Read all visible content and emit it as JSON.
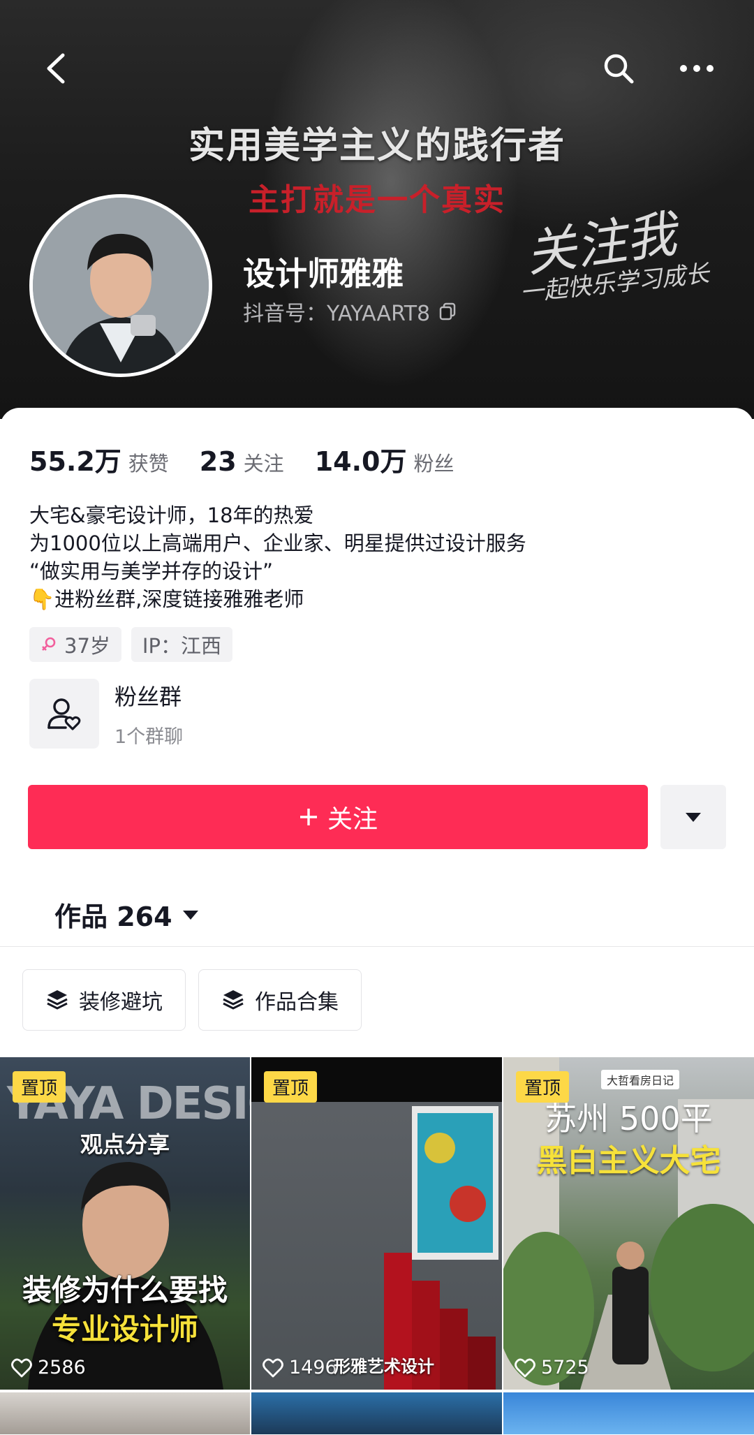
{
  "banner": {
    "headline": "实用美学主义的践行者",
    "subline": "主打就是一个真实",
    "script_big": "关注我",
    "script_small": "一起快乐学习成长"
  },
  "profile": {
    "name": "设计师雅雅",
    "douyin_id": "抖音号：YAYAART8"
  },
  "stats": [
    {
      "value": "55.2万",
      "label": "获赞"
    },
    {
      "value": "23",
      "label": "关注"
    },
    {
      "value": "14.0万",
      "label": "粉丝"
    }
  ],
  "bio": [
    "大宅&豪宅设计师，18年的热爱",
    "为1000位以上高端用户、企业家、明星提供过设计服务",
    "“做实用与美学并存的设计”",
    "👇进粉丝群,深度链接雅雅老师"
  ],
  "tags": {
    "age": "37岁",
    "ip": "IP：江西"
  },
  "fan_group": {
    "title": "粉丝群",
    "subtitle": "1个群聊"
  },
  "follow_button": "关注",
  "works_tab": "作品 264",
  "chips": [
    "装修避坑",
    "作品合集"
  ],
  "videos": [
    {
      "pinned": "置顶",
      "likes": "2586",
      "overlay_top": "YAYA DESIGN",
      "overlay_sub": "观点分享",
      "overlay_line1": "装修为什么要找",
      "overlay_line2": "专业设计师"
    },
    {
      "pinned": "置顶",
      "likes": "1496",
      "overlay_tag": "形雅艺术设计"
    },
    {
      "pinned": "置顶",
      "likes": "5725",
      "overlay_small": "大哲看房日记",
      "overlay_line1": "苏州 500平",
      "overlay_line2": "黑白主义大宅"
    }
  ],
  "colors": {
    "follow_red": "#fe2c55",
    "pin_yellow": "#fdd847"
  }
}
